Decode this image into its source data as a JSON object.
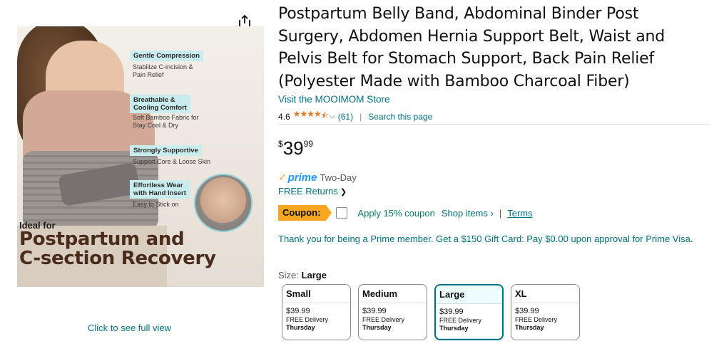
{
  "image": {
    "feature_1_title": "Gentle Compression",
    "feature_1_desc_1": "Stabilize C-incision &",
    "feature_1_desc_2": "Pain Relief",
    "feature_2_title_1": "Breathable &",
    "feature_2_title_2": "Cooling Comfort",
    "feature_2_desc_1": "Soft Bamboo Fabric for",
    "feature_2_desc_2": "Stay Cool & Dry",
    "feature_3_title": "Strongly Supportive",
    "feature_3_desc": "Support Core & Loose Skin",
    "feature_4_title_1": "Effortless Wear",
    "feature_4_title_2": "with Hand Insert",
    "feature_4_desc": "Easy to Stick on",
    "ideal_for": "Ideal for",
    "headline_1": "Postpartum and",
    "headline_2": "C-section Recovery",
    "full_view_link": "Click to see full view",
    "share_icon": "share-icon"
  },
  "product": {
    "title": "Postpartum Belly Band, Abdominal Binder Post Surgery, Abdomen Hernia Support Belt, Waist and Pelvis Belt for Stomach Support, Back Pain Relief (Polyester Made with Bamboo Charcoal Fiber)",
    "store_link": "Visit the MOOIMOM Store",
    "rating": "4.6",
    "stars_icon": "star-rating-icon",
    "rating_count": "(61)",
    "search_page": "Search this page",
    "price_symbol": "$",
    "price_whole": "39",
    "price_fraction": "99",
    "prime_label": "prime",
    "prime_speed": "Two-Day",
    "free_returns": "FREE Returns",
    "coupon_badge": "Coupon:",
    "coupon_apply": "Apply 15% coupon",
    "coupon_shop": "Shop items ›",
    "coupon_sep": "|",
    "coupon_terms": "Terms",
    "prime_offer": "Thank you for being a Prime member. Get a $150 Gift Card: Pay $0.00 upon approval for Prime Visa.",
    "size_label": "Size:",
    "size_selected": "Large"
  },
  "sizes": [
    {
      "name": "Small",
      "price": "$39.99",
      "delivery": "FREE Delivery",
      "day": "Thursday"
    },
    {
      "name": "Medium",
      "price": "$39.99",
      "delivery": "FREE Delivery",
      "day": "Thursday"
    },
    {
      "name": "Large",
      "price": "$39.99",
      "delivery": "FREE Delivery",
      "day": "Thursday"
    },
    {
      "name": "XL",
      "price": "$39.99",
      "delivery": "FREE Delivery",
      "day": "Thursday"
    }
  ],
  "colors": {
    "link": "#007185",
    "star": "#DE7921",
    "prime_blue": "#1A98FF",
    "coupon": "#F7A621",
    "coupon_green": "#067D62"
  }
}
